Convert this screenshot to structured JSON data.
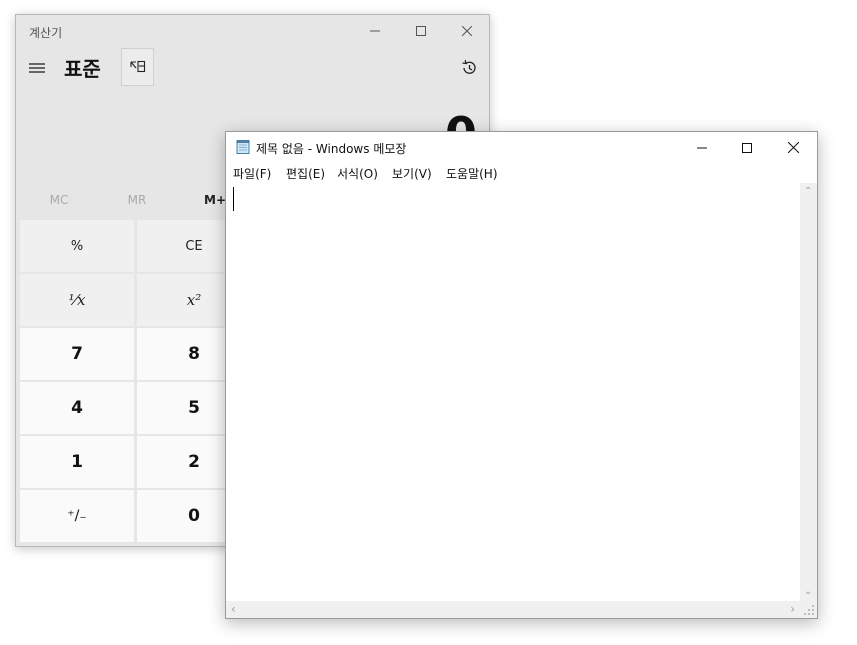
{
  "calculator": {
    "window_title": "계산기",
    "mode_title": "표준",
    "display_value": "0",
    "memory": [
      "MC",
      "MR",
      "M+"
    ],
    "keys": {
      "r1": [
        "%",
        "CE"
      ],
      "r2": [
        "⅟x",
        "x²"
      ],
      "r3": [
        "7",
        "8"
      ],
      "r4": [
        "4",
        "5"
      ],
      "r5": [
        "1",
        "2"
      ],
      "r6": [
        "⁺/₋",
        "0"
      ]
    }
  },
  "notepad": {
    "window_title": "제목 없음 - Windows 메모장",
    "menu": [
      "파일(F)",
      "편집(E)",
      "서식(O)",
      "보기(V)",
      "도움말(H)"
    ],
    "content": ""
  }
}
